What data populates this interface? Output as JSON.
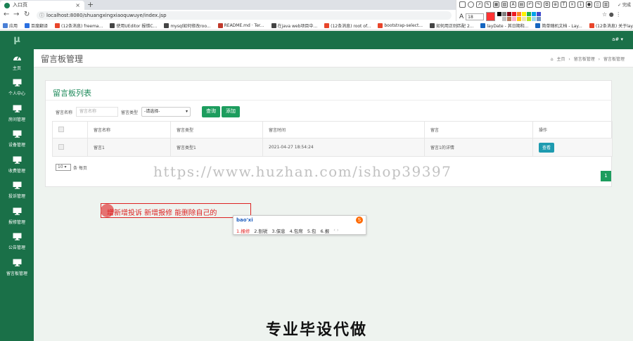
{
  "browser": {
    "tab_title": "入口页",
    "url": "localhost:8080/shuangxingxiaoquwuye/index.jsp",
    "bookmarks": [
      {
        "label": "应用",
        "color": "#4a7fd6"
      },
      {
        "label": "百度翻译",
        "color": "#2a6fe0"
      },
      {
        "label": "(12条消息) freema...",
        "color": "#e8452b"
      },
      {
        "label": "使用UEditor 报错C...",
        "color": "#444444"
      },
      {
        "label": "mysql如何修改roo...",
        "color": "#444444"
      },
      {
        "label": "README.md · Ter...",
        "color": "#c0392b"
      },
      {
        "label": "在java web项目中...",
        "color": "#444444"
      },
      {
        "label": "(12条消息) root of...",
        "color": "#e8452b"
      },
      {
        "label": "bootstrap-select...",
        "color": "#e8452b"
      },
      {
        "label": "如何用正则匹配 2...",
        "color": "#444444"
      },
      {
        "label": "layDate - 其日期和...",
        "color": "#1565c0"
      },
      {
        "label": "简单随机文档 - Lay...",
        "color": "#1565c0"
      },
      {
        "label": "(12条消息) 关于lay...",
        "color": "#e8452b"
      }
    ],
    "annotation_toolbar": {
      "done_label": "✓ 完成",
      "font_size": "18",
      "current_color": "#ff3333",
      "palette": [
        "#000000",
        "#7f7f7f",
        "#880015",
        "#ed1c24",
        "#ff7f27",
        "#fff200",
        "#22b14c",
        "#00a2e8",
        "#3f48cc",
        "#ffffff",
        "#c3c3c3",
        "#b97a57",
        "#ffaec9",
        "#ffc90e",
        "#efe4b0",
        "#b5e61d",
        "#99d9ea",
        "#7092be"
      ]
    }
  },
  "app": {
    "logo": "μ",
    "user_menu": "a# ▾"
  },
  "sidebar": {
    "items": [
      {
        "label": "主页",
        "icon": "dashboard-icon"
      },
      {
        "label": "个人中心",
        "icon": "monitor-icon"
      },
      {
        "label": "房间管理",
        "icon": "monitor-icon"
      },
      {
        "label": "设备管理",
        "icon": "monitor-icon"
      },
      {
        "label": "收费管理",
        "icon": "monitor-icon"
      },
      {
        "label": "投诉管理",
        "icon": "monitor-icon"
      },
      {
        "label": "报修管理",
        "icon": "monitor-icon"
      },
      {
        "label": "公告管理",
        "icon": "monitor-icon"
      },
      {
        "label": "留言板管理",
        "icon": "monitor-icon"
      }
    ]
  },
  "page": {
    "title": "留言板管理",
    "breadcrumb": [
      "主页",
      "留言板管理",
      "留言板管理"
    ]
  },
  "panel": {
    "title": "留言板列表",
    "filter": {
      "name_label": "留言名称",
      "name_placeholder": "留言名称",
      "type_label": "留言类型",
      "type_selected": "-请选择-",
      "search_label": "查询",
      "add_label": "添加"
    },
    "table": {
      "headers": [
        "",
        "留言名称",
        "留言类型",
        "留言时间",
        "留言",
        "操作"
      ],
      "rows": [
        {
          "name": "留言1",
          "type": "留言类型1",
          "time": "2021-04-27 18:54:24",
          "content": "留言1的详情",
          "action": "查看"
        }
      ]
    },
    "pager": {
      "page_size": "10",
      "page_size_suffix": "条 每页",
      "current_page": "1"
    }
  },
  "overlay": {
    "watermark": "https://www.huzhan.com/ishop39397",
    "annotation_text": "增新增投诉 新增报修 能删除自己的",
    "ime": {
      "input": "bao'xi",
      "candidates": [
        "1.报修",
        "2.刨锐",
        "3.保息",
        "4.包席",
        "5.包",
        "6.报"
      ],
      "nav": "‹ ›"
    },
    "caption": "专业毕设代做"
  }
}
